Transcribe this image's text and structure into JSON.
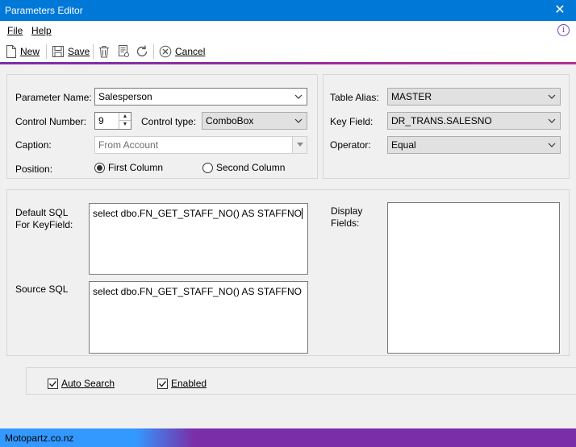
{
  "window": {
    "title": "Parameters Editor",
    "close_glyph": "✕"
  },
  "menu": {
    "items": [
      {
        "label": "File"
      },
      {
        "label": "Help"
      }
    ],
    "info_glyph": "i"
  },
  "toolbar": {
    "new_label": "New",
    "save_label": "Save",
    "cancel_label": "Cancel"
  },
  "form": {
    "param_name_label": "Parameter Name:",
    "param_name_value": "Salesperson",
    "control_number_label": "Control Number:",
    "control_number_value": "9",
    "control_type_label": "Control type:",
    "control_type_value": "ComboBox",
    "caption_label": "Caption:",
    "caption_value": "From Account",
    "position_label": "Position:",
    "position_options": [
      {
        "label": "First Column",
        "selected": true
      },
      {
        "label": "Second Column",
        "selected": false
      }
    ],
    "table_alias_label": "Table Alias:",
    "table_alias_value": "MASTER",
    "key_field_label": "Key Field:",
    "key_field_value": "DR_TRANS.SALESNO",
    "operator_label": "Operator:",
    "operator_value": "Equal"
  },
  "sql": {
    "default_label_line1": "Default SQL",
    "default_label_line2": "For KeyField:",
    "default_value": "select dbo.FN_GET_STAFF_NO() AS STAFFNO",
    "source_label": "Source SQL",
    "source_value": "select dbo.FN_GET_STAFF_NO() AS STAFFNO",
    "display_label_line1": "Display",
    "display_label_line2": "Fields:"
  },
  "options": {
    "auto_search_label": "Auto Search",
    "auto_search_checked": true,
    "enabled_label": "Enabled",
    "enabled_checked": true
  },
  "status": {
    "text": "Motopartz.co.nz"
  },
  "colors": {
    "titlebar": "#0078d7",
    "accent": "#7a2fa8",
    "icon": "#7b3fb0"
  },
  "icons": [
    "close-icon",
    "info-icon",
    "new-doc-icon",
    "save-icon",
    "delete-icon",
    "report-icon",
    "refresh-icon",
    "cancel-icon",
    "chevron-down-icon",
    "check-icon"
  ]
}
